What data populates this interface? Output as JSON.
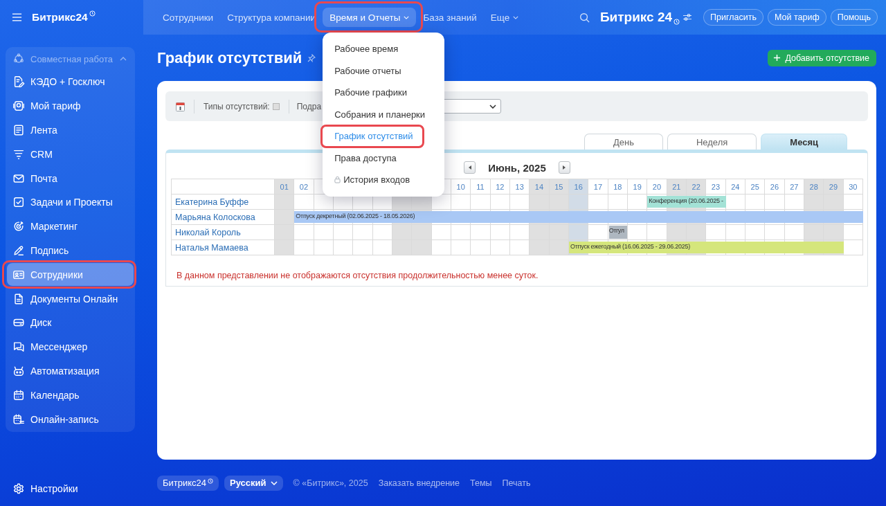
{
  "sidebar": {
    "logo": "Битрикс24",
    "section": {
      "label": "Совместная работа",
      "expanded": true
    },
    "items": [
      {
        "label": "КЭДО + Госключ",
        "selected": false,
        "highlighted": false
      },
      {
        "label": "Мой тариф",
        "selected": false,
        "highlighted": false
      },
      {
        "label": "Лента",
        "selected": false,
        "highlighted": false
      },
      {
        "label": "CRM",
        "selected": false,
        "highlighted": false
      },
      {
        "label": "Почта",
        "selected": false,
        "highlighted": false
      },
      {
        "label": "Задачи и Проекты",
        "selected": false,
        "highlighted": false
      },
      {
        "label": "Маркетинг",
        "selected": false,
        "highlighted": false
      },
      {
        "label": "Подпись",
        "selected": false,
        "highlighted": false
      },
      {
        "label": "Сотрудники",
        "selected": true,
        "highlighted": true
      },
      {
        "label": "Документы Онлайн",
        "selected": false,
        "highlighted": false
      },
      {
        "label": "Диск",
        "selected": false,
        "highlighted": false
      },
      {
        "label": "Мессенджер",
        "selected": false,
        "highlighted": false
      },
      {
        "label": "Автоматизация",
        "selected": false,
        "highlighted": false
      },
      {
        "label": "Календарь",
        "selected": false,
        "highlighted": false
      },
      {
        "label": "Онлайн-запись",
        "selected": false,
        "highlighted": false
      }
    ],
    "settings": "Настройки"
  },
  "topbar": {
    "nav": [
      {
        "label": "Сотрудники",
        "selected": false,
        "dropdown": false,
        "highlighted": false
      },
      {
        "label": "Структура компании",
        "selected": false,
        "dropdown": false,
        "highlighted": false
      },
      {
        "label": "Время и Отчеты",
        "selected": true,
        "dropdown": true,
        "highlighted": true
      },
      {
        "label": "База знаний",
        "selected": false,
        "dropdown": false,
        "highlighted": false
      },
      {
        "label": "Еще",
        "selected": false,
        "dropdown": true,
        "highlighted": false
      }
    ],
    "brand": "Битрикс 24",
    "buttons": [
      "Пригласить",
      "Мой тариф",
      "Помощь"
    ]
  },
  "menu": {
    "items": [
      {
        "label": "Рабочее время",
        "selected": false,
        "highlighted": false,
        "locked": false
      },
      {
        "label": "Рабочие отчеты",
        "selected": false,
        "highlighted": false,
        "locked": false
      },
      {
        "label": "Рабочие графики",
        "selected": false,
        "highlighted": false,
        "locked": false
      },
      {
        "label": "Собрания и планерки",
        "selected": false,
        "highlighted": false,
        "locked": false
      },
      {
        "label": "График отсутствий",
        "selected": true,
        "highlighted": true,
        "locked": false
      },
      {
        "label": "Права доступа",
        "selected": false,
        "highlighted": false,
        "locked": false
      },
      {
        "label": "История входов",
        "selected": false,
        "highlighted": false,
        "locked": true
      }
    ]
  },
  "page": {
    "title": "График отсутствий",
    "add_button": "Добавить отсутствие"
  },
  "filters": {
    "types_label": "Типы отсутствий:",
    "types_checked": false,
    "department_label": "Подра"
  },
  "view_tabs": [
    {
      "label": "День",
      "selected": false
    },
    {
      "label": "Неделя",
      "selected": false
    },
    {
      "label": "Месяц",
      "selected": true
    }
  ],
  "calendar": {
    "month": "Июнь, 2025",
    "days": [
      {
        "label": "01",
        "weekend": true,
        "today": false
      },
      {
        "label": "02",
        "weekend": false,
        "today": false
      },
      {
        "weekend": false,
        "today": false
      },
      {
        "weekend": false,
        "today": false
      },
      {
        "weekend": false,
        "today": false
      },
      {
        "weekend": false,
        "today": false
      },
      {
        "weekend": true,
        "today": false
      },
      {
        "weekend": true,
        "today": false
      },
      {
        "weekend": false,
        "today": false
      },
      {
        "label": "10",
        "weekend": false,
        "today": false
      },
      {
        "label": "11",
        "weekend": false,
        "today": false
      },
      {
        "label": "12",
        "weekend": false,
        "today": false
      },
      {
        "label": "13",
        "weekend": false,
        "today": false
      },
      {
        "label": "14",
        "weekend": true,
        "today": false
      },
      {
        "label": "15",
        "weekend": true,
        "today": false
      },
      {
        "label": "16",
        "weekend": false,
        "today": true
      },
      {
        "label": "17",
        "weekend": false,
        "today": false
      },
      {
        "label": "18",
        "weekend": false,
        "today": false
      },
      {
        "label": "19",
        "weekend": false,
        "today": false
      },
      {
        "label": "20",
        "weekend": false,
        "today": false
      },
      {
        "label": "21",
        "weekend": true,
        "today": false
      },
      {
        "label": "22",
        "weekend": true,
        "today": false
      },
      {
        "label": "23",
        "weekend": false,
        "today": false
      },
      {
        "label": "24",
        "weekend": false,
        "today": false
      },
      {
        "label": "25",
        "weekend": false,
        "today": false
      },
      {
        "label": "26",
        "weekend": false,
        "today": false
      },
      {
        "label": "27",
        "weekend": false,
        "today": false
      },
      {
        "label": "28",
        "weekend": true,
        "today": false
      },
      {
        "label": "29",
        "weekend": true,
        "today": false
      },
      {
        "label": "30",
        "weekend": false,
        "today": false
      }
    ],
    "rows": [
      {
        "name": "Екатерина Буффе",
        "days": [
          {
            "absent": false
          },
          {
            "absent": false
          },
          {
            "absent": false
          },
          {
            "absent": false
          },
          {
            "absent": false
          },
          {
            "absent": false
          },
          {
            "absent": false
          },
          {
            "absent": false
          },
          {
            "absent": false
          },
          {
            "absent": false
          },
          {
            "absent": false
          },
          {
            "absent": false
          },
          {
            "absent": false
          },
          {
            "absent": false
          },
          {
            "absent": false
          },
          {
            "absent": false
          },
          {
            "absent": false
          },
          {
            "absent": false
          },
          {
            "absent": false
          },
          {
            "absent": true
          },
          {
            "absent": true
          },
          {
            "absent": true
          },
          {
            "absent": true
          },
          {
            "absent": false
          },
          {
            "absent": false
          },
          {
            "absent": false
          },
          {
            "absent": false
          },
          {
            "absent": false
          },
          {
            "absent": false
          },
          {
            "absent": false
          }
        ],
        "absences": [
          {
            "label": "Конференция (20.06.2025 -",
            "color": "#a3e2d6"
          }
        ]
      },
      {
        "name": "Марьяна Колоскова",
        "days": [
          {
            "absent": false
          },
          {
            "absent": true
          },
          {
            "absent": true
          },
          {
            "absent": true
          },
          {
            "absent": true
          },
          {
            "absent": true
          },
          {
            "absent": true
          },
          {
            "absent": true
          },
          {
            "absent": true
          },
          {
            "absent": true
          },
          {
            "absent": true
          },
          {
            "absent": true
          },
          {
            "absent": true
          },
          {
            "absent": true
          },
          {
            "absent": true
          },
          {
            "absent": true
          },
          {
            "absent": true
          },
          {
            "absent": true
          },
          {
            "absent": true
          },
          {
            "absent": true
          },
          {
            "absent": true
          },
          {
            "absent": true
          },
          {
            "absent": true
          },
          {
            "absent": true
          },
          {
            "absent": true
          },
          {
            "absent": true
          },
          {
            "absent": true
          },
          {
            "absent": true
          },
          {
            "absent": true
          },
          {
            "absent": true
          }
        ],
        "absences": [
          {
            "label": "Отпуск декретный (02.06.2025 - 18.05.2026)",
            "color": "#a9c8f5"
          }
        ]
      },
      {
        "name": "Николай Король",
        "days": [
          {
            "absent": false
          },
          {
            "absent": false
          },
          {
            "absent": false
          },
          {
            "absent": false
          },
          {
            "absent": false
          },
          {
            "absent": false
          },
          {
            "absent": false
          },
          {
            "absent": false
          },
          {
            "absent": false
          },
          {
            "absent": false
          },
          {
            "absent": false
          },
          {
            "absent": false
          },
          {
            "absent": false
          },
          {
            "absent": false
          },
          {
            "absent": false
          },
          {
            "absent": false
          },
          {
            "absent": false
          },
          {
            "absent": true
          },
          {
            "absent": false
          },
          {
            "absent": false
          },
          {
            "absent": false
          },
          {
            "absent": false
          },
          {
            "absent": false
          },
          {
            "absent": false
          },
          {
            "absent": false
          },
          {
            "absent": false
          },
          {
            "absent": false
          },
          {
            "absent": false
          },
          {
            "absent": false
          },
          {
            "absent": false
          }
        ],
        "absences": [
          {
            "label": "Отгул",
            "color": "#aeb7c0"
          }
        ]
      },
      {
        "name": "Наталья Мамаева",
        "days": [
          {
            "absent": false
          },
          {
            "absent": false
          },
          {
            "absent": false
          },
          {
            "absent": false
          },
          {
            "absent": false
          },
          {
            "absent": false
          },
          {
            "absent": false
          },
          {
            "absent": false
          },
          {
            "absent": false
          },
          {
            "absent": false
          },
          {
            "absent": false
          },
          {
            "absent": false
          },
          {
            "absent": false
          },
          {
            "absent": false
          },
          {
            "absent": false
          },
          {
            "absent": true
          },
          {
            "absent": true
          },
          {
            "absent": true
          },
          {
            "absent": true
          },
          {
            "absent": true
          },
          {
            "absent": true
          },
          {
            "absent": true
          },
          {
            "absent": true
          },
          {
            "absent": true
          },
          {
            "absent": true
          },
          {
            "absent": true
          },
          {
            "absent": true
          },
          {
            "absent": true
          },
          {
            "absent": true
          },
          {
            "absent": false
          }
        ],
        "absences": [
          {
            "label": "Отпуск ежегодный (16.06.2025 - 29.06.2025)",
            "color": "#d5e67c"
          }
        ]
      }
    ],
    "note": "В данном представлении не отображаются отсутствия продолжительностью менее суток."
  },
  "footer": {
    "brand": "Битрикс24",
    "language": "Русский",
    "copyright": "© «Битрикс», 2025",
    "links": [
      "Заказать внедрение",
      "Темы",
      "Печать"
    ]
  }
}
